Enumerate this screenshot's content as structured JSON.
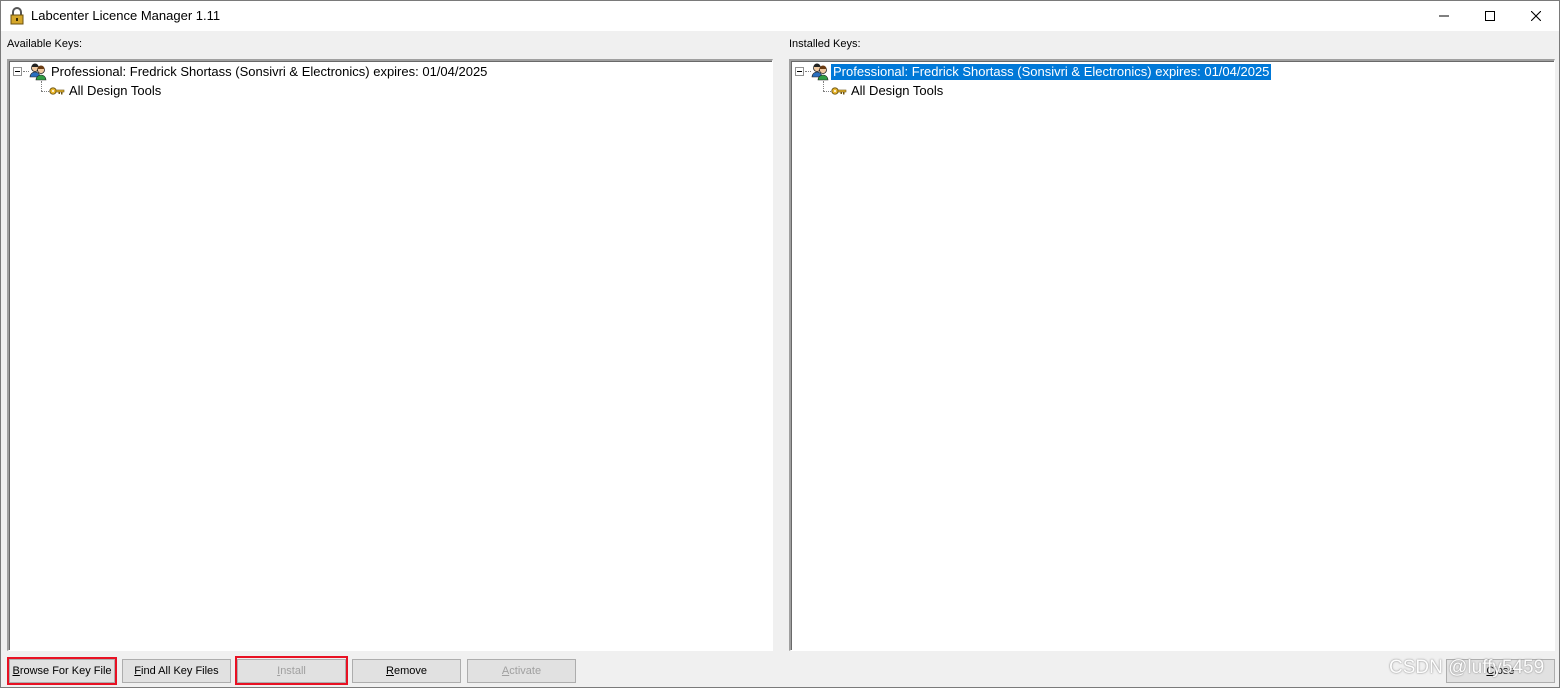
{
  "window": {
    "title": "Labcenter Licence Manager 1.11",
    "icon": "padlock-icon"
  },
  "available": {
    "label": "Available Keys:",
    "root": "Professional:  Fredrick Shortass (Sonsivri & Electronics) expires: 01/04/2025",
    "child": "All Design Tools"
  },
  "installed": {
    "label": "Installed Keys:",
    "root": "Professional:  Fredrick Shortass (Sonsivri & Electronics) expires: 01/04/2025",
    "child": "All Design Tools",
    "selected": true
  },
  "buttons": {
    "browse": {
      "mnemonic": "B",
      "rest": "rowse For Key File"
    },
    "find": {
      "mnemonic": "F",
      "rest": "ind All Key Files"
    },
    "install": {
      "mnemonic": "I",
      "rest": "nstall",
      "enabled": false
    },
    "remove": {
      "mnemonic": "R",
      "rest": "emove"
    },
    "activate": {
      "mnemonic": "A",
      "rest": "ctivate",
      "enabled": false
    },
    "close": {
      "mnemonic": "C",
      "rest": "lose"
    }
  },
  "watermark": "CSDN @luffy5459",
  "colors": {
    "selection": "#0078d7",
    "highlight_box": "#e81123",
    "face": "#f0f0f0"
  }
}
